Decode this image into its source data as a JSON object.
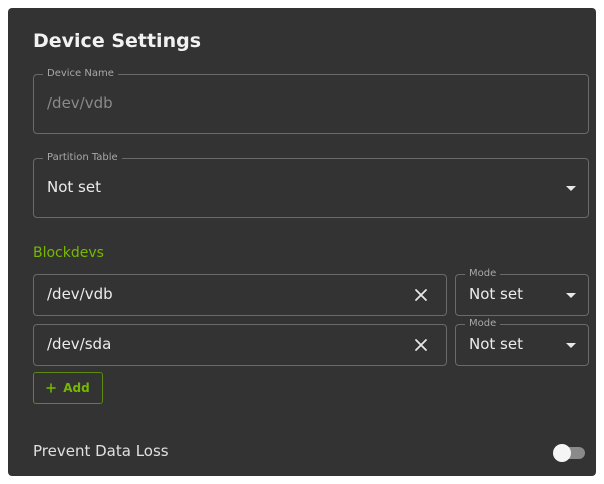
{
  "title": "Device Settings",
  "device_name": {
    "label": "Device Name",
    "placeholder": "/dev/vdb"
  },
  "partition_table": {
    "label": "Partition Table",
    "value": "Not set"
  },
  "blockdevs": {
    "label": "Blockdevs",
    "items": [
      {
        "path": "/dev/vdb",
        "mode_label": "Mode",
        "mode_value": "Not set"
      },
      {
        "path": "/dev/sda",
        "mode_label": "Mode",
        "mode_value": "Not set"
      }
    ],
    "add_label": "Add"
  },
  "prevent_data_loss": {
    "label": "Prevent Data Loss",
    "enabled": false
  },
  "colors": {
    "accent": "#76b900",
    "panel": "#333333",
    "border": "#6a6a6a"
  },
  "icons": {
    "dropdown": "caret-down-icon",
    "clear": "close-icon",
    "add": "plus-icon"
  }
}
